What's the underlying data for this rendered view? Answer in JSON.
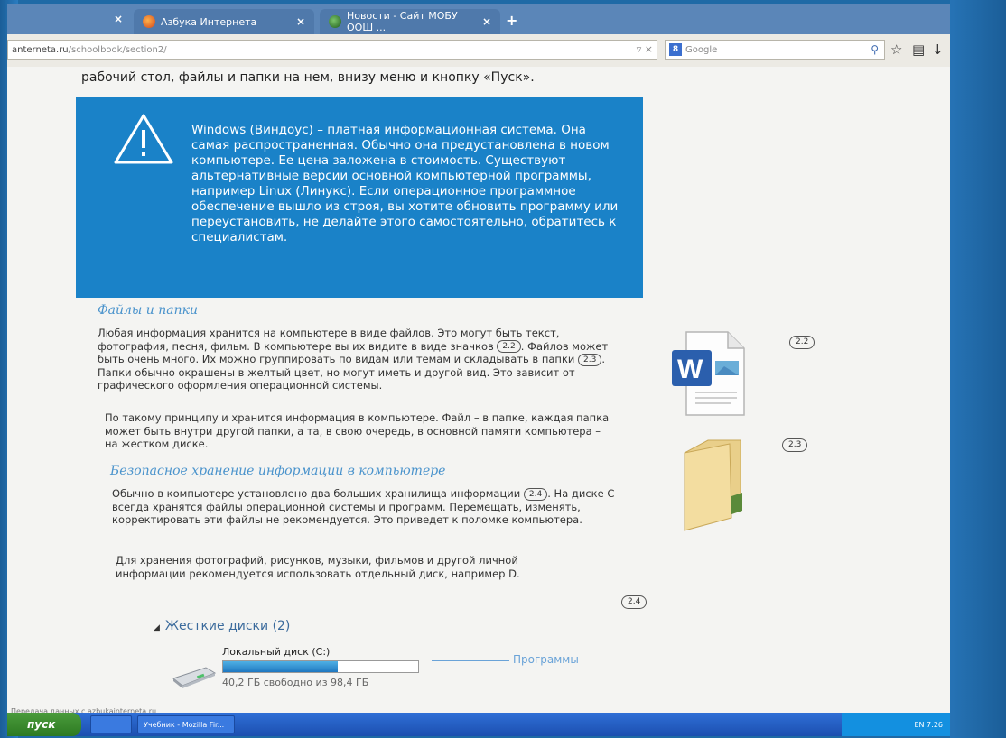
{
  "browser": {
    "tabs": [
      {
        "label": "Азбука Интернета",
        "active": false
      },
      {
        "label": "Новости - Сайт МОБУ ООШ ...",
        "active": false
      }
    ],
    "tab_close": "×",
    "new_tab": "+",
    "url_domain": "anterneta.ru",
    "url_path": "/schoolbook/section2/",
    "url_controls": "▿ ×",
    "search_engine_badge": "8",
    "search_placeholder": "Google"
  },
  "page": {
    "lead_line": "рабочий стол, файлы и папки на нем, внизу меню и кнопку «Пуск».",
    "alert_text": "Windows (Виндоус) – платная информационная система. Она самая распространенная. Обычно она предустановлена в новом компьютере. Ее цена заложена в стоимость. Существуют альтернативные версии основной компьютерной программы, например Linux (Линукс). Если операционное программное обеспечение вышло из строя, вы хотите обновить программу или переустановить, не делайте этого самостоятельно, обратитесь к специалистам.",
    "section1_title": "Файлы и папки",
    "section1_p1_a": "Любая информация хранится на компьютере в виде файлов. Это могут быть текст, фотография, песня, фильм. В компьютере вы их видите в виде значков",
    "section1_p1_b": ". Файлов может быть очень много. Их можно группировать по видам или темам и складывать в папки",
    "section1_p1_c": ". Папки обычно окрашены в желтый цвет, но могут иметь и другой вид. Это зависит от графического оформления операционной системы.",
    "section1_p2": "По такому принципу и хранится информация в компьютере. Файл – в папке, каждая папка может быть внутри другой папки, а та, в свою очередь, в основной памяти компьютера – на жестком диске.",
    "section2_title": "Безопасное хранение информации в компьютере",
    "section2_p1_a": "Обычно в компьютере установлено два больших хранилища информации",
    "section2_p1_b": ". На диске С всегда хранятся файлы операционной системы и программ. Перемещать, изменять, корректировать эти файлы не рекомендуется. Это приведет к поломке компьютера.",
    "section2_p2": "Для хранения фотографий, рисунков, музыки, фильмов и другой личной информации рекомендуется использовать отдельный диск, например D.",
    "ref_22": "2.2",
    "ref_23": "2.3",
    "ref_24": "2.4",
    "disks_header": "Жесткие диски (2)",
    "disk_name": "Локальный диск (C:)",
    "disk_free": "40,2 ГБ свободно из 98,4 ГБ",
    "disk_used_fraction": 0.59,
    "programs_label": "Программы",
    "status_text": "Передача данных с azbukainterneta.ru..."
  },
  "taskbar": {
    "start_label": "пуск",
    "task_label": "Учебник - Mozilla Fir...",
    "tray_text": "EN  7:26"
  },
  "icons": [
    "firefox-icon",
    "globe-icon",
    "warning-icon",
    "word-document-icon",
    "folder-icon",
    "hard-disk-icon",
    "star-icon",
    "bookmarks-icon",
    "download-icon",
    "home-icon",
    "search-icon"
  ],
  "colors": {
    "alert_bg": "#1a82c8",
    "heading": "#4a93cc",
    "accent_link": "#6aa3d8"
  }
}
